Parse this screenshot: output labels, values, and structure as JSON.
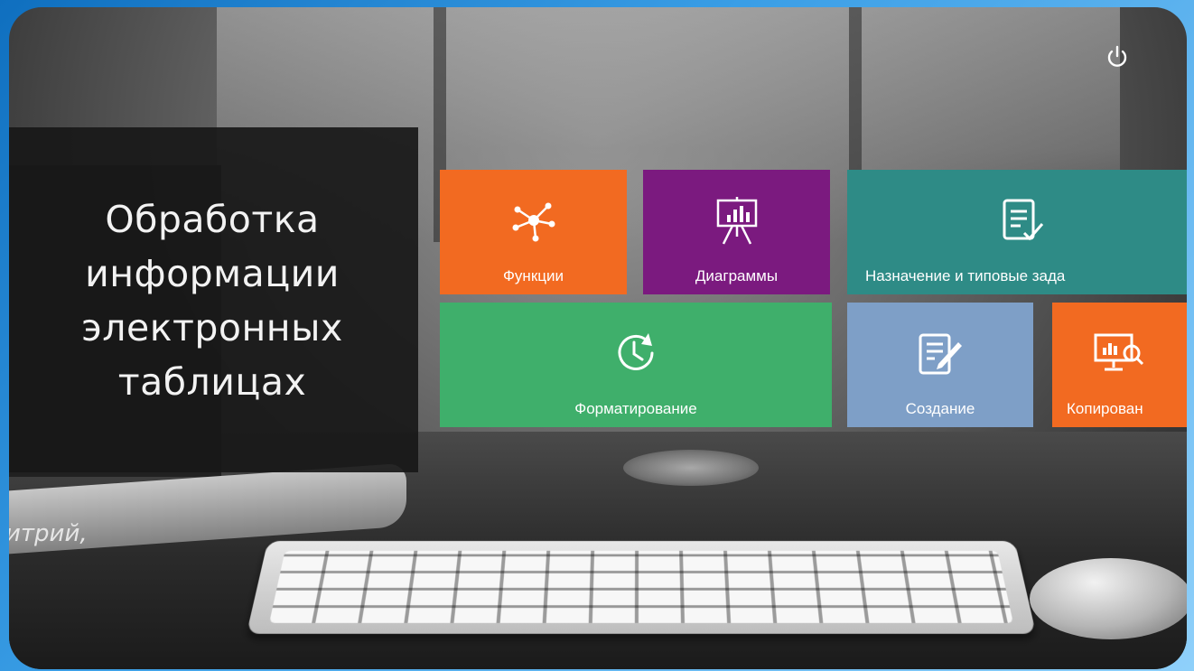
{
  "slide": {
    "title_lines": [
      "Обработка",
      "информации",
      "электронных",
      "таблицах"
    ],
    "author_fragment": "итрий,"
  },
  "tiles": [
    {
      "id": "functions",
      "label": "Функции",
      "icon": "network-nodes-icon",
      "color": "#f26a21"
    },
    {
      "id": "charts",
      "label": "Диаграммы",
      "icon": "presentation-chart-icon",
      "color": "#7b1a7f"
    },
    {
      "id": "purpose",
      "label": "Назначение и типовые зада",
      "icon": "document-check-icon",
      "color": "#2e8b86"
    },
    {
      "id": "format",
      "label": "Форматирование",
      "icon": "clock-history-icon",
      "color": "#3faf6b"
    },
    {
      "id": "create",
      "label": "Создание",
      "icon": "document-edit-icon",
      "color": "#7e9fc7"
    },
    {
      "id": "copy",
      "label": "Копирован",
      "icon": "monitor-search-icon",
      "color": "#f26a21"
    }
  ],
  "controls": {
    "power_icon": "power-icon"
  }
}
